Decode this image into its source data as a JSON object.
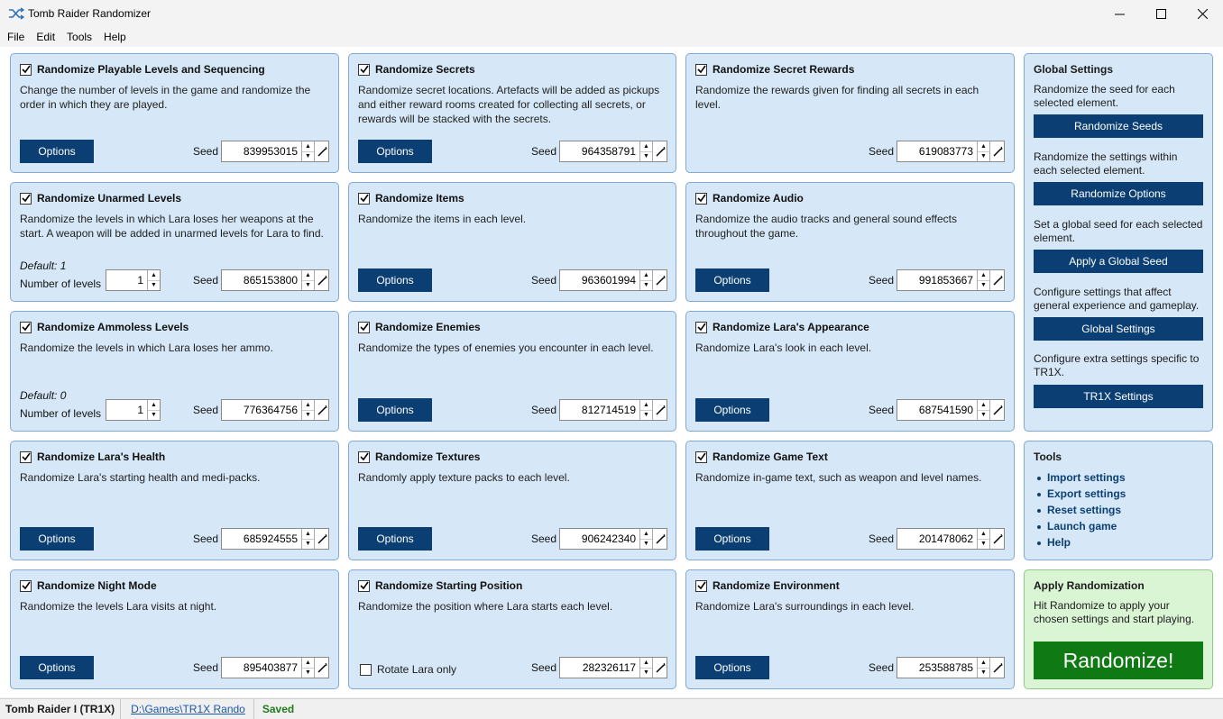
{
  "window": {
    "title": "Tomb Raider Randomizer",
    "icon": "shuffle-icon"
  },
  "menu": [
    "File",
    "Edit",
    "Tools",
    "Help"
  ],
  "common": {
    "options_label": "Options",
    "seed_label": "Seed",
    "number_of_levels_label": "Number of levels"
  },
  "panels": [
    {
      "title": "Randomize Playable Levels and Sequencing",
      "checked": true,
      "desc": "Change the number of levels in the game and randomize the order in which they are played.",
      "seed": "839953015"
    },
    {
      "title": "Randomize Secrets",
      "checked": true,
      "desc": "Randomize secret locations. Artefacts will be added as pickups and either reward rooms created for collecting all secrets, or rewards will be stacked with the secrets.",
      "seed": "964358791"
    },
    {
      "title": "Randomize Secret Rewards",
      "checked": true,
      "desc": "Randomize the rewards given for finding all secrets in each level.",
      "seed": "619083773"
    },
    {
      "title": "Randomize Unarmed Levels",
      "checked": true,
      "desc": "Randomize the levels in which Lara loses her weapons at the start. A weapon will be added in unarmed levels for Lara to find.",
      "seed": "865153800",
      "default": "Default: 1",
      "levels": "1"
    },
    {
      "title": "Randomize Items",
      "checked": true,
      "desc": "Randomize the items in each level.",
      "seed": "963601994"
    },
    {
      "title": "Randomize Audio",
      "checked": true,
      "desc": "Randomize the audio tracks and general sound effects throughout the game.",
      "seed": "991853667"
    },
    {
      "title": "Randomize Ammoless Levels",
      "checked": true,
      "desc": "Randomize the levels in which Lara loses her ammo.",
      "seed": "776364756",
      "default": "Default: 0",
      "levels": "1"
    },
    {
      "title": "Randomize Enemies",
      "checked": true,
      "desc": "Randomize the types of enemies you encounter in each level.",
      "seed": "812714519"
    },
    {
      "title": "Randomize Lara's Appearance",
      "checked": true,
      "desc": "Randomize Lara's look in each level.",
      "seed": "687541590"
    },
    {
      "title": "Randomize Lara's Health",
      "checked": true,
      "desc": "Randomize Lara's starting health and medi-packs.",
      "seed": "685924555"
    },
    {
      "title": "Randomize Textures",
      "checked": true,
      "desc": "Randomly apply texture packs to each level.",
      "seed": "906242340"
    },
    {
      "title": "Randomize Game Text",
      "checked": true,
      "desc": "Randomize in-game text, such as weapon and level names.",
      "seed": "201478062"
    },
    {
      "title": "Randomize Night Mode",
      "checked": true,
      "desc": "Randomize the levels Lara visits at night.",
      "seed": "895403877"
    },
    {
      "title": "Randomize Starting Position",
      "checked": true,
      "desc": "Randomize the position where Lara starts each level.",
      "seed": "282326117",
      "rotate_label": "Rotate Lara only",
      "rotate_checked": false
    },
    {
      "title": "Randomize Environment",
      "checked": true,
      "desc": "Randomize Lara's surroundings in each level.",
      "seed": "253588785"
    }
  ],
  "global_settings": {
    "title": "Global Settings",
    "items": [
      {
        "desc": "Randomize the seed for each selected element.",
        "button": "Randomize Seeds"
      },
      {
        "desc": "Randomize the settings within each selected element.",
        "button": "Randomize Options"
      },
      {
        "desc": "Set a global seed for each selected element.",
        "button": "Apply a Global Seed"
      },
      {
        "desc": "Configure settings that affect general experience and gameplay.",
        "button": "Global Settings"
      },
      {
        "desc": "Configure extra settings specific to TR1X.",
        "button": "TR1X Settings"
      }
    ]
  },
  "tools": {
    "title": "Tools",
    "links": [
      "Import settings",
      "Export settings",
      "Reset settings",
      "Launch game",
      "Help"
    ]
  },
  "apply": {
    "title": "Apply Randomization",
    "desc": "Hit Randomize to apply your chosen settings and start playing.",
    "button": "Randomize!"
  },
  "status": {
    "game": "Tomb Raider I (TR1X)",
    "path": "D:\\Games\\TR1X Rando",
    "state": "Saved"
  },
  "colors": {
    "panel_bg": "#d6e8f8",
    "button_bg": "#0b3f73",
    "apply_bg": "#daf5d4",
    "randomize_bg": "#0f7a14",
    "saved_text": "#1f7a1f"
  }
}
